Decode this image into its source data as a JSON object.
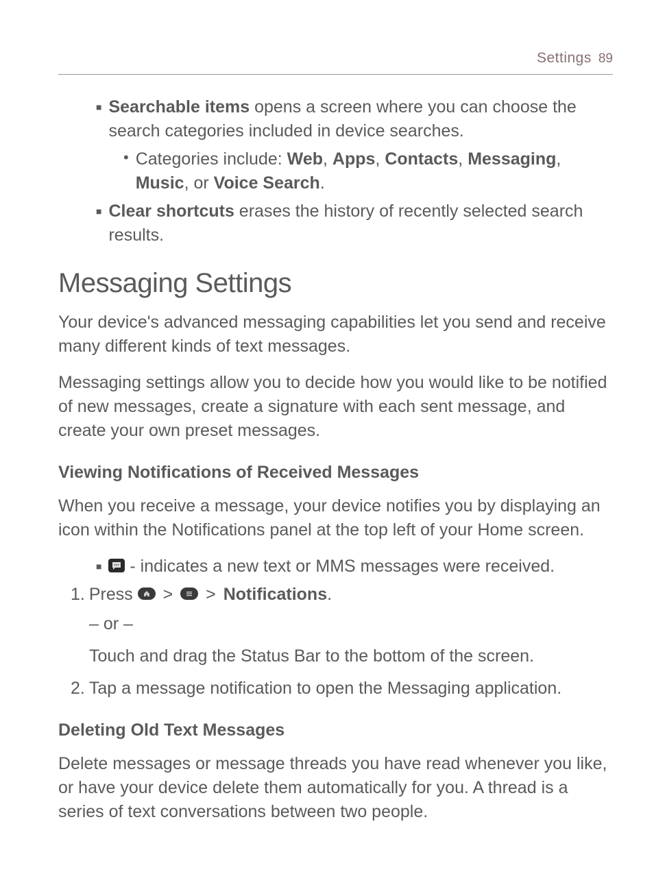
{
  "header": {
    "section": "Settings",
    "page": "89"
  },
  "searchable": {
    "lead_bold": "Searchable items",
    "lead_rest": " opens a screen where you can choose the search categories included in device searches.",
    "categories_prefix": "Categories include: ",
    "cat1": "Web",
    "cat2": "Apps",
    "cat3": "Contacts",
    "cat4": "Messaging",
    "cat5": "Music",
    "cat6": "Voice Search",
    "sep": ", ",
    "or": ", or ",
    "period": "."
  },
  "clear": {
    "lead_bold": "Clear shortcuts",
    "lead_rest": " erases the history of recently selected search results."
  },
  "messaging": {
    "title": "Messaging Settings",
    "intro1": "Your device's advanced messaging capabilities let you send and receive many different kinds of text messages.",
    "intro2": "Messaging settings allow you to decide how you would like to be notified of new messages, create a signature with each sent message, and create your own preset messages."
  },
  "viewing": {
    "title": "Viewing Notifications of Received Messages",
    "p1": "When you receive a message, your device notifies you by displaying an icon within the Notifications panel at the top left of your Home screen.",
    "bullet_rest": " - indicates a new text or MMS messages were received.",
    "step1_prefix": "Press ",
    "step1_sep": " > ",
    "step1_bold": "Notifications",
    "step1_period": ".",
    "or_text": "– or –",
    "or_touch": "Touch and drag the Status Bar to the bottom of the screen.",
    "step2": "Tap a message notification to open the Messaging application."
  },
  "deleting": {
    "title": "Deleting Old Text Messages",
    "p1": "Delete messages or message threads you have read whenever you like, or have your device delete them automatically for you. A thread is a series of text conversations between two people."
  },
  "markers": {
    "square": "■",
    "bullet": "•",
    "n1": "1.",
    "n2": "2."
  }
}
